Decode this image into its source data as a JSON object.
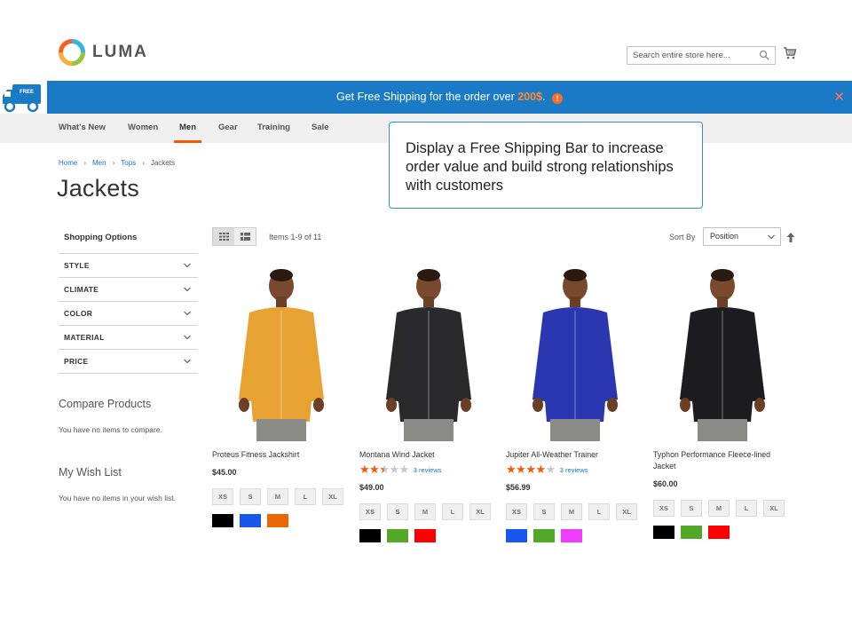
{
  "header": {
    "logo_text": "LUMA",
    "search_placeholder": "Search entire store here..."
  },
  "shipping_bar": {
    "truck_badge": "FREE",
    "message_prefix": "Get Free Shipping for the order over ",
    "amount": "200$",
    "message_suffix": ".",
    "info_icon": "!",
    "close": "✕"
  },
  "nav": {
    "items": [
      "What's New",
      "Women",
      "Men",
      "Gear",
      "Training",
      "Sale"
    ],
    "active": "Men"
  },
  "callout": {
    "text": "Display a Free Shipping Bar to increase order value and build strong relationships with customers"
  },
  "breadcrumb": {
    "items": [
      "Home",
      "Men",
      "Tops"
    ],
    "current": "Jackets"
  },
  "page_title": "Jackets",
  "sidebar": {
    "shopping_options": "Shopping Options",
    "filters": [
      "STYLE",
      "CLIMATE",
      "COLOR",
      "MATERIAL",
      "PRICE"
    ],
    "compare_title": "Compare Products",
    "compare_text": "You have no items to compare.",
    "wishlist_title": "My Wish List",
    "wishlist_text": "You have no items in your wish list."
  },
  "toolbar": {
    "amount": "Items 1-9 of 11",
    "sort_label": "Sort By",
    "sort_value": "Position"
  },
  "products": [
    {
      "name": "Proteus Fitness Jackshirt",
      "price": "$45.00",
      "stars": 0,
      "reviews": "",
      "jacket_color": "#e7a233",
      "sizes": [
        "XS",
        "S",
        "M",
        "L",
        "XL"
      ],
      "colors": [
        "#000000",
        "#1856ee",
        "#eb6703"
      ]
    },
    {
      "name": "Montana Wind Jacket",
      "price": "$49.00",
      "stars": 2.5,
      "reviews": "3 reviews",
      "jacket_color": "#2a2a2c",
      "sizes": [
        "XS",
        "S",
        "M",
        "L",
        "XL"
      ],
      "colors": [
        "#000000",
        "#53a828",
        "#ff0000"
      ]
    },
    {
      "name": "Jupiter All-Weather Trainer",
      "price": "$56.99",
      "stars": 4,
      "reviews": "3 reviews",
      "jacket_color": "#2a37b0",
      "sizes": [
        "XS",
        "S",
        "M",
        "L",
        "XL"
      ],
      "colors": [
        "#1856ee",
        "#53a828",
        "#ef3dff"
      ]
    },
    {
      "name": "Typhon Performance Fleece-lined Jacket",
      "price": "$60.00",
      "stars": 0,
      "reviews": "",
      "jacket_color": "#1c1c1e",
      "sizes": [
        "XS",
        "S",
        "M",
        "L",
        "XL"
      ],
      "colors": [
        "#000000",
        "#53a828",
        "#ff0000"
      ]
    }
  ],
  "colors": {
    "accent": "#ff5501",
    "bar_blue": "#1b7ac6",
    "link": "#1979c3"
  }
}
